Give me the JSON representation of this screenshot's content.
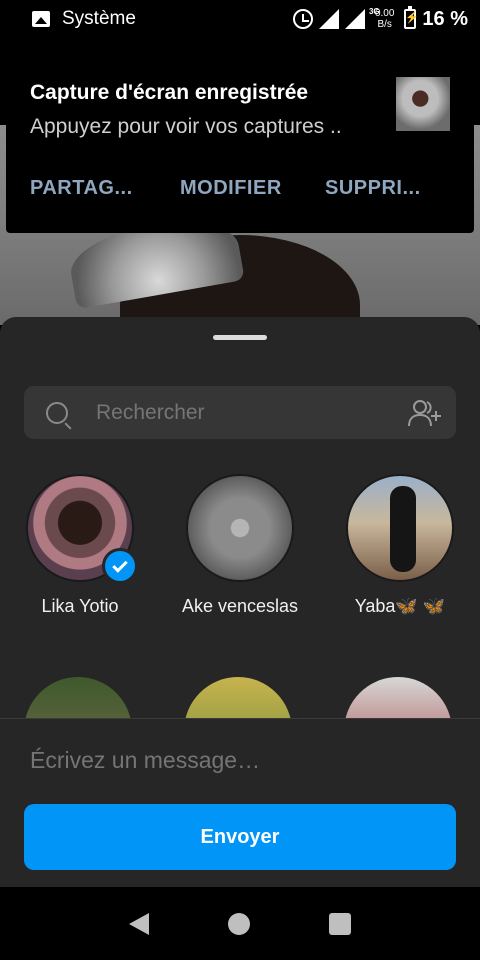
{
  "status_bar": {
    "app_name": "Système",
    "net_speed_value": "0.00",
    "net_speed_unit": "B/s",
    "battery": "16 %",
    "network_label": "3G"
  },
  "notification": {
    "title": "Capture d'écran enregistrée",
    "subtitle": "Appuyez pour voir vos captures ..",
    "actions": [
      "PARTAG...",
      "MODIFIER",
      "SUPPRI..."
    ]
  },
  "sheet": {
    "search_placeholder": "Rechercher",
    "contacts": [
      {
        "name": "Lika Yotio",
        "selected": true
      },
      {
        "name": "Ake venceslas",
        "selected": false
      },
      {
        "name": "Yaba🦋 🦋",
        "selected": false
      }
    ],
    "message_placeholder": "Écrivez un message…",
    "send_label": "Envoyer"
  },
  "colors": {
    "accent": "#0095f6",
    "sheet_bg": "#262626",
    "action_text": "#8ea7bf"
  },
  "icons": [
    "image-icon",
    "alarm-icon",
    "signal-icon",
    "battery-icon",
    "search-icon",
    "add-people-icon",
    "check-icon",
    "back-icon",
    "home-icon",
    "recents-icon"
  ]
}
